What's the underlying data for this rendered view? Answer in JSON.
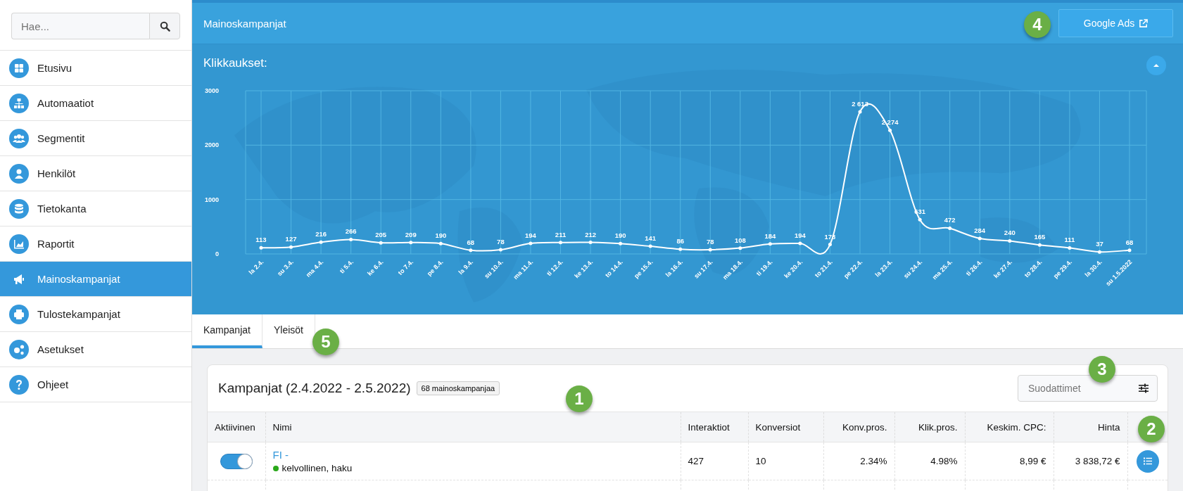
{
  "sidebar": {
    "search": {
      "placeholder": "Hae..."
    },
    "items": [
      {
        "label": "Etusivu",
        "selected": false
      },
      {
        "label": "Automaatiot",
        "selected": false
      },
      {
        "label": "Segmentit",
        "selected": false
      },
      {
        "label": "Henkilöt",
        "selected": false
      },
      {
        "label": "Tietokanta",
        "selected": false
      },
      {
        "label": "Raportit",
        "selected": false
      },
      {
        "label": "Mainoskampanjat",
        "selected": true
      },
      {
        "label": "Tulostekampanjat",
        "selected": false
      },
      {
        "label": "Asetukset",
        "selected": false
      },
      {
        "label": "Ohjeet",
        "selected": false
      }
    ]
  },
  "header": {
    "title": "Mainoskampanjat",
    "button": "Google Ads"
  },
  "chart_panel": {
    "title": "Klikkaukset:",
    "chart_data": {
      "type": "line",
      "categories": [
        "la 2.4.",
        "su 3.4.",
        "ma 4.4.",
        "ti 5.4.",
        "ke 6.4.",
        "to 7.4.",
        "pe 8.4.",
        "la 9.4.",
        "su 10.4.",
        "ma 11.4.",
        "ti 12.4.",
        "ke 13.4.",
        "to 14.4.",
        "pe 15.4.",
        "la 16.4.",
        "su 17.4.",
        "ma 18.4.",
        "ti 19.4.",
        "ke 20.4.",
        "to 21.4.",
        "pe 22.4.",
        "la 23.4.",
        "su 24.4.",
        "ma 25.4.",
        "ti 26.4.",
        "ke 27.4.",
        "to 28.4.",
        "pe 29.4.",
        "la 30.4.",
        "su 1.5.2022"
      ],
      "series": [
        {
          "color": "#ffffff",
          "values": [
            113,
            127,
            216,
            266,
            205,
            209,
            190,
            68,
            78,
            194,
            211,
            212,
            190,
            141,
            86,
            78,
            108,
            184,
            194,
            173,
            2613,
            2274,
            631,
            472,
            284,
            240,
            165,
            111,
            37,
            68
          ]
        }
      ],
      "value_labels": [
        "113",
        "127",
        "216",
        "266",
        "205",
        "209",
        "190",
        "68",
        "78",
        "194",
        "211",
        "212",
        "190",
        "141",
        "86",
        "78",
        "108",
        "184",
        "194",
        "173",
        "2 613",
        "2 274",
        "631",
        "472",
        "284",
        "240",
        "165",
        "111",
        "37",
        "68"
      ],
      "ylim": [
        0,
        3000
      ],
      "yticks": [
        0,
        1000,
        2000,
        3000
      ],
      "grid": true
    }
  },
  "tabs": [
    {
      "label": "Kampanjat",
      "selected": true
    },
    {
      "label": "Yleisöt",
      "selected": false
    }
  ],
  "card": {
    "title": "Kampanjat (2.4.2022 - 2.5.2022)",
    "badge": "68 mainoskampanjaa",
    "filter": {
      "placeholder": "Suodattimet"
    },
    "table": {
      "columns": [
        "Aktiivinen",
        "Nimi",
        "Interaktiot",
        "Konversiot",
        "Konv.pros.",
        "Klik.pros.",
        "Keskim. CPC:",
        "Hinta"
      ],
      "rows": [
        {
          "cells": [
            {
              "kind": "toggle",
              "on": true
            },
            {
              "kind": "campaign",
              "name": "FI -",
              "status": "kelvollinen, haku",
              "color": "#2aa81a"
            },
            "427",
            "10",
            "2.34%",
            "4.98%",
            "8,99 €",
            "3 838,72 €"
          ]
        }
      ]
    }
  },
  "markers": [
    {
      "label": "4"
    },
    {
      "label": "5"
    },
    {
      "label": "1"
    },
    {
      "label": "3"
    },
    {
      "label": "2"
    }
  ]
}
